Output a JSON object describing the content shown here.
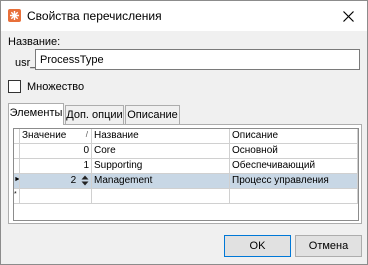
{
  "window": {
    "title": "Свойства перечисления",
    "accent": "#e8703a"
  },
  "form": {
    "name_label": "Название:",
    "name_prefix": "usr_",
    "name_value": "ProcessType",
    "multi_label": "Множество",
    "multi_checked": false
  },
  "tabs": [
    {
      "label": "Элементы",
      "active": true
    },
    {
      "label": "Доп. опции",
      "active": false
    },
    {
      "label": "Описание",
      "active": false
    }
  ],
  "grid": {
    "headers": {
      "value": "Значение",
      "name": "Название",
      "desc": "Описание"
    },
    "rows": [
      {
        "value": "0",
        "name": "Core",
        "desc": "Основной",
        "selected": false
      },
      {
        "value": "1",
        "name": "Supporting",
        "desc": "Обеспечивающий",
        "selected": false
      },
      {
        "value": "2",
        "name": "Management",
        "desc": "Процесс управления",
        "selected": true
      }
    ],
    "current_marker": "►",
    "new_marker": "*"
  },
  "buttons": {
    "ok": "OK",
    "cancel": "Отмена"
  }
}
